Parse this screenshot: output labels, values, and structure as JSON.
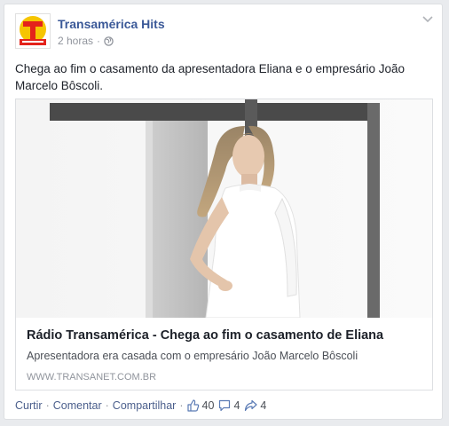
{
  "post": {
    "page_name": "Transamérica Hits",
    "time": "2 horas",
    "separator": "·",
    "text": "Chega ao fim o casamento da apresentadora Eliana e o empresário João Marcelo Bôscoli."
  },
  "link": {
    "title": "Rádio Transamérica - Chega ao fim o casamento de Eliana",
    "description": "Apresentadora era casada com o empresário João Marcelo Bôscoli",
    "domain": "WWW.TRANSANET.COM.BR"
  },
  "actions": {
    "like": "Curtir",
    "comment": "Comentar",
    "share": "Compartilhar",
    "dot": "·",
    "likes_count": "40",
    "comments_count": "4",
    "shares_count": "4"
  },
  "icons": {
    "avatar": "transamerica-logo-icon",
    "audience": "globe-icon",
    "menu": "chevron-down-icon",
    "likes": "thumbs-up-icon",
    "comments": "comment-bubble-icon",
    "shares": "share-arrow-icon"
  },
  "colors": {
    "link_blue": "#3b5998",
    "text": "#1d2129",
    "muted": "#90949c",
    "logo_red": "#e4231b",
    "logo_yellow": "#f6c500"
  }
}
